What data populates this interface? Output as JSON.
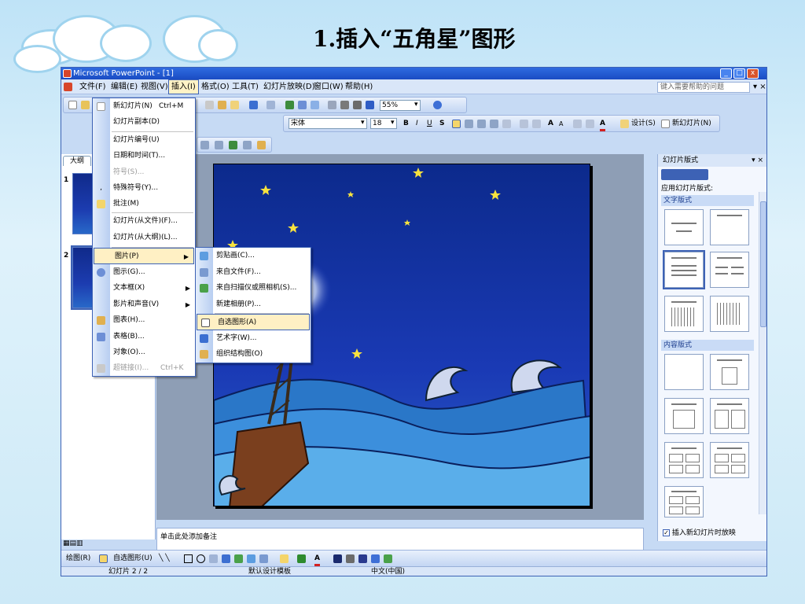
{
  "slide_title": "1.插入“五角星”图形",
  "window": {
    "title": "Microsoft PowerPoint - [1]",
    "buttons": [
      "_",
      "□",
      "x"
    ]
  },
  "menubar": {
    "items": [
      "文件(F)",
      "编辑(E)",
      "视图(V)",
      "插入(I)",
      "格式(O)",
      "工具(T)",
      "幻灯片放映(D)",
      "窗口(W)",
      "帮助(H)"
    ],
    "help_placeholder": "键入需要帮助的问题"
  },
  "toolbar": {
    "zoom": "55%",
    "font": "宋体",
    "font_size": "18",
    "design_label": "设计(S)",
    "new_slide_label": "新幻灯片(N)"
  },
  "leftpane": {
    "tab": "大纲",
    "slide_numbers": [
      "1",
      "2"
    ]
  },
  "insert_menu": {
    "items": [
      {
        "label": "新幻灯片(N)",
        "shortcut": "Ctrl+M"
      },
      {
        "label": "幻灯片副本(D)"
      },
      {
        "label": "幻灯片编号(U)"
      },
      {
        "label": "日期和时间(T)..."
      },
      {
        "label": "符号(S)..."
      },
      {
        "label": "特殊符号(Y)..."
      },
      {
        "label": "批注(M)"
      },
      {
        "label": "幻灯片(从文件)(F)..."
      },
      {
        "label": "幻灯片(从大纲)(L)..."
      },
      {
        "label": "图片(P)"
      },
      {
        "label": "图示(G)..."
      },
      {
        "label": "文本框(X)"
      },
      {
        "label": "影片和声音(V)"
      },
      {
        "label": "图表(H)..."
      },
      {
        "label": "表格(B)..."
      },
      {
        "label": "对象(O)..."
      },
      {
        "label": "超链接(I)...",
        "shortcut": "Ctrl+K"
      }
    ]
  },
  "picture_submenu": {
    "items": [
      "剪贴画(C)...",
      "来自文件(F)...",
      "来自扫描仪或照相机(S)...",
      "新建相册(P)...",
      "自选图形(A)",
      "艺术字(W)...",
      "组织结构图(O)"
    ]
  },
  "notes_placeholder": "单击此处添加备注",
  "taskpane": {
    "title": "幻灯片版式",
    "apply_label": "应用幻灯片版式:",
    "text_layouts": "文字版式",
    "content_layouts": "内容版式",
    "checkbox_label": "插入新幻灯片时放映"
  },
  "drawbar": {
    "draw_label": "绘图(R)",
    "autoshape_label": "自选图形(U)"
  },
  "statusbar": {
    "slide_info": "幻灯片 2 / 2",
    "template": "默认设计模板",
    "language": "中文(中国)"
  }
}
